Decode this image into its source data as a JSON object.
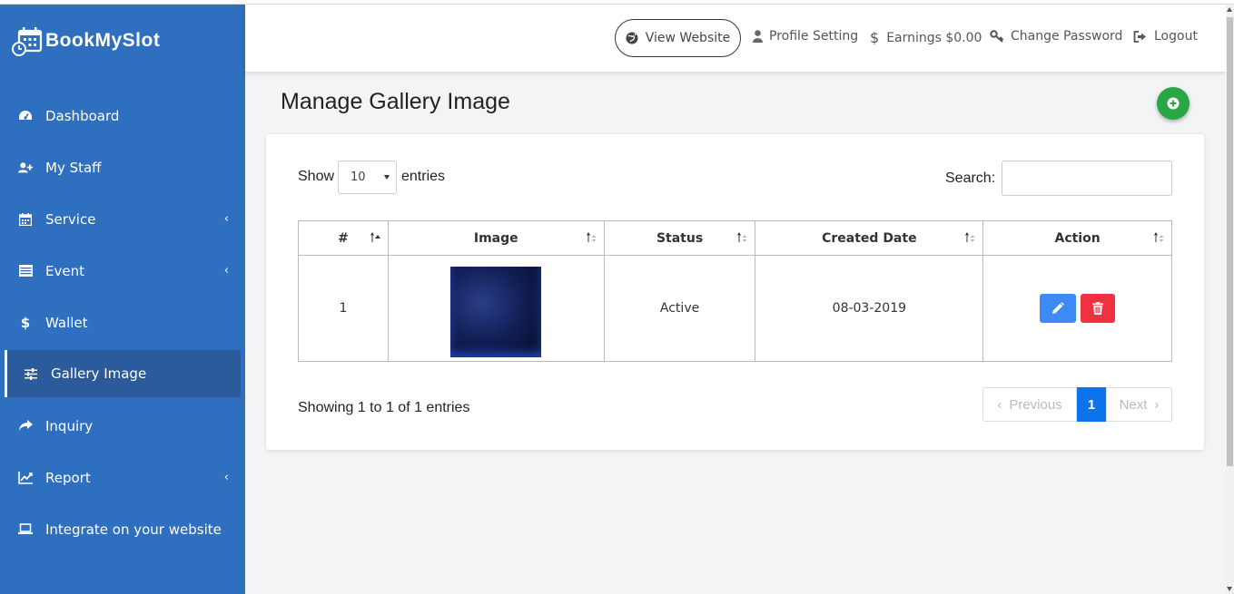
{
  "brand": {
    "name": "BookMySlot"
  },
  "sidebar": {
    "items": [
      {
        "label": "Dashboard",
        "icon": "dashboard-icon",
        "has_submenu": false,
        "active": false
      },
      {
        "label": "My Staff",
        "icon": "user-plus-icon",
        "has_submenu": false,
        "active": false
      },
      {
        "label": "Service",
        "icon": "calendar-icon",
        "has_submenu": true,
        "active": false
      },
      {
        "label": "Event",
        "icon": "list-icon",
        "has_submenu": true,
        "active": false
      },
      {
        "label": "Wallet",
        "icon": "dollar-icon",
        "has_submenu": false,
        "active": false
      },
      {
        "label": "Gallery Image",
        "icon": "sliders-icon",
        "has_submenu": false,
        "active": true
      },
      {
        "label": "Inquiry",
        "icon": "share-icon",
        "has_submenu": false,
        "active": false
      },
      {
        "label": "Report",
        "icon": "chart-icon",
        "has_submenu": true,
        "active": false
      },
      {
        "label": "Integrate on your website",
        "icon": "laptop-icon",
        "has_submenu": false,
        "active": false
      }
    ]
  },
  "header": {
    "view_website": "View Website",
    "profile_setting": "Profile Setting",
    "earnings": "Earnings $0.00",
    "change_password": "Change Password",
    "logout": "Logout"
  },
  "page": {
    "title": "Manage Gallery Image"
  },
  "table_controls": {
    "show_label": "Show",
    "entries_label": "entries",
    "page_size": "10",
    "search_label": "Search:",
    "search_value": ""
  },
  "table": {
    "columns": [
      "#",
      "Image",
      "Status",
      "Created Date",
      "Action"
    ],
    "rows": [
      {
        "num": "1",
        "image": "gallery-thumbnail",
        "status": "Active",
        "created": "08-03-2019"
      }
    ]
  },
  "footer": {
    "info": "Showing 1 to 1 of 1 entries",
    "prev": "Previous",
    "current_page": "1",
    "next": "Next"
  },
  "colors": {
    "sidebar": "#2e6fbf",
    "sidebar_active": "#2b5b9a",
    "add_button": "#28a745",
    "edit_button": "#3d8af7",
    "delete_button": "#f0313f",
    "page_active": "#0d73ec"
  }
}
